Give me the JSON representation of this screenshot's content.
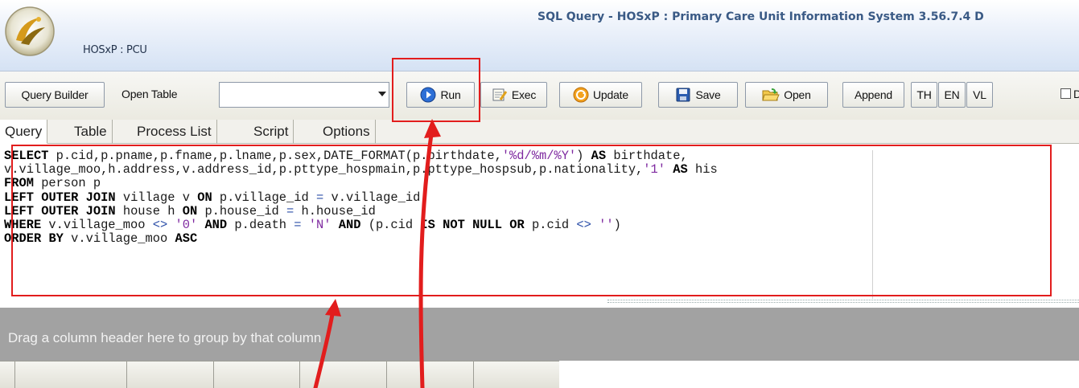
{
  "window": {
    "title": "SQL Query -  HOSxP : Primary Care Unit Information System 3.56.7.4 D",
    "app_name": "HOSxP : PCU"
  },
  "toolbar": {
    "query_builder": "Query Builder",
    "open_table_label": "Open Table",
    "open_table_value": "",
    "run": "Run",
    "exec": "Exec",
    "update": "Update",
    "save": "Save",
    "open": "Open",
    "append": "Append",
    "th": "TH",
    "en": "EN",
    "vl": "VL",
    "checkbox_label": "D"
  },
  "tabs": [
    "Query",
    "Table",
    "Process List",
    "Script",
    "Options"
  ],
  "editor": {
    "sql_lines": [
      "SELECT p.cid,p.pname,p.fname,p.lname,p.sex,DATE_FORMAT(p.birthdate,'%d/%m/%Y') AS birthdate,",
      "v.village_moo,h.address,v.address_id,p.pttype_hospmain,p.pttype_hospsub,p.nationality,'1' AS his",
      "FROM person p",
      "LEFT OUTER JOIN village v ON p.village_id = v.village_id",
      "LEFT OUTER JOIN house h ON p.house_id = h.house_id",
      "WHERE v.village_moo <> '0' AND p.death = 'N' AND (p.cid IS NOT NULL OR p.cid <> '')",
      "ORDER BY v.village_moo ASC"
    ]
  },
  "grid": {
    "group_hint": "Drag a column header here to group by that column"
  },
  "colors": {
    "annotation": "#e21d1d",
    "title_text": "#3a5a85"
  }
}
